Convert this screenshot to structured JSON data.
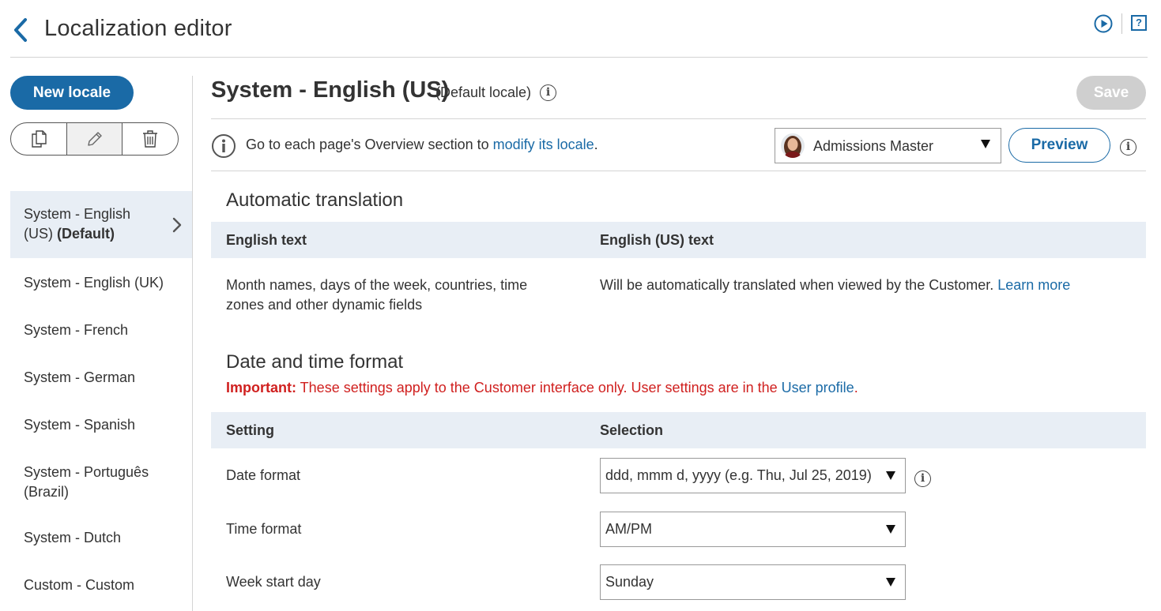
{
  "header": {
    "title": "Localization editor",
    "back_icon": "chevron-left-icon",
    "play_icon": "play-circle-icon",
    "help_icon": "help-icon",
    "help_glyph": "?"
  },
  "sidebar": {
    "new_locale_label": "New locale",
    "toolbar": {
      "copy_icon": "copy-icon",
      "edit_icon": "pencil-icon",
      "delete_icon": "trash-icon"
    },
    "locales": [
      {
        "line1": "System - English",
        "line2_plain": "(US) ",
        "line2_bold": "(Default)",
        "selected": true
      },
      {
        "line1": "System - English (UK)"
      },
      {
        "line1": "System - French"
      },
      {
        "line1": "System - German"
      },
      {
        "line1": "System - Spanish"
      },
      {
        "line1": "System - Português",
        "line2_plain": "(Brazil)"
      },
      {
        "line1": "System - Dutch"
      },
      {
        "line1": "Custom - Custom"
      }
    ]
  },
  "main": {
    "title": "System - English (US)",
    "default_label": "(Default locale)",
    "save_label": "Save",
    "notice": {
      "prefix": "Go to each page's Overview section to ",
      "link": "modify its locale",
      "suffix": "."
    },
    "user_select": {
      "value": "Admissions Master"
    },
    "preview_label": "Preview",
    "auto_translation": {
      "title": "Automatic translation",
      "col1": "English text",
      "col2": "English (US) text",
      "row_text_1": "Month names, days of the week, countries, time",
      "row_text_2": "zones and other dynamic fields",
      "row_value": "Will be automatically translated when viewed by the Customer. ",
      "learn_more": "Learn more"
    },
    "date_time": {
      "title": "Date and time format",
      "important_label": "Important:",
      "important_text": " These settings apply to the Customer interface only. User settings are in the ",
      "user_profile_link": "User profile",
      "important_suffix": ".",
      "col1": "Setting",
      "col2": "Selection",
      "rows": [
        {
          "label": "Date format",
          "value": "ddd, mmm d, yyyy (e.g. Thu, Jul 25, 2019)"
        },
        {
          "label": "Time format",
          "value": "AM/PM"
        },
        {
          "label": "Week start day",
          "value": "Sunday"
        }
      ]
    },
    "info_glyph": "i"
  },
  "colors": {
    "accent": "#1a6aa6",
    "table_header": "#e8eef5",
    "important": "#d0201f",
    "disabled": "#cfcfcf"
  }
}
